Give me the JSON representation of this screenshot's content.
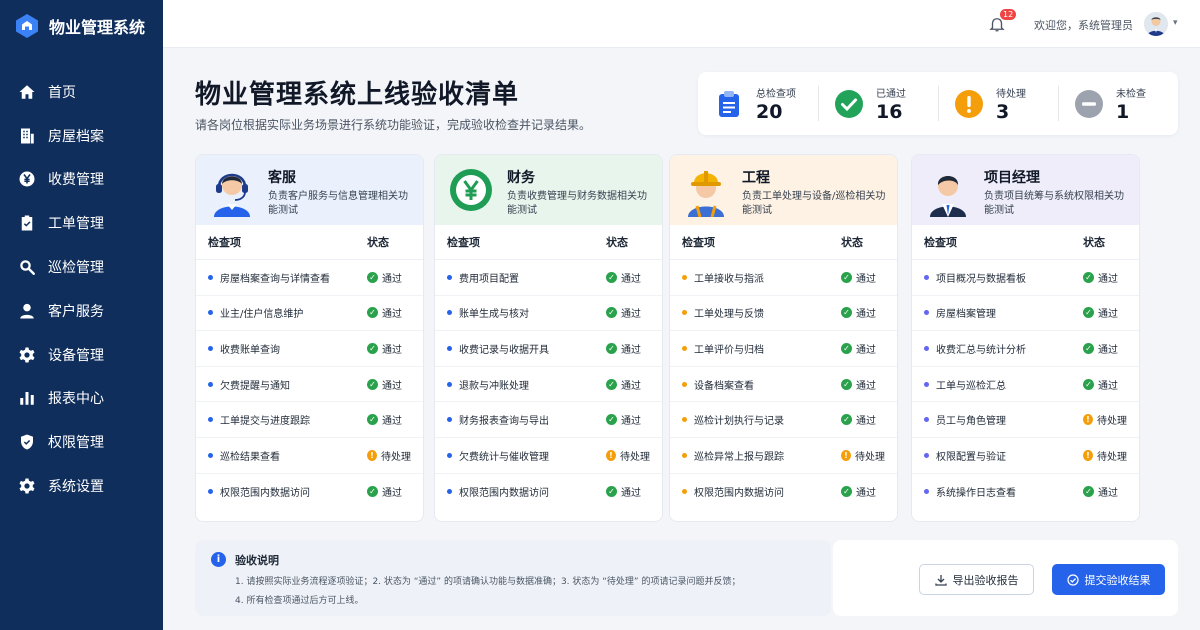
{
  "brand": {
    "title": "物业管理系统"
  },
  "sidebar": {
    "items": [
      {
        "label": "首页",
        "icon": "home-icon"
      },
      {
        "label": "房屋档案",
        "icon": "building-icon"
      },
      {
        "label": "收费管理",
        "icon": "yen-icon"
      },
      {
        "label": "工单管理",
        "icon": "clipboard-icon"
      },
      {
        "label": "巡检管理",
        "icon": "search-icon"
      },
      {
        "label": "客户服务",
        "icon": "user-icon"
      },
      {
        "label": "设备管理",
        "icon": "gear-icon"
      },
      {
        "label": "报表中心",
        "icon": "bar-chart-icon"
      },
      {
        "label": "权限管理",
        "icon": "shield-icon"
      },
      {
        "label": "系统设置",
        "icon": "settings-icon"
      }
    ]
  },
  "topbar": {
    "notification_count": "12",
    "welcome": "欢迎您，系统管理员"
  },
  "page": {
    "title": "物业管理系统上线验收清单",
    "subtitle": "请各岗位根据实际业务场景进行系统功能验证，完成验收检查并记录结果。"
  },
  "stats": [
    {
      "label": "总检查项",
      "value": "20",
      "color": "#2563eb"
    },
    {
      "label": "已通过",
      "value": "16",
      "color": "#22a35a"
    },
    {
      "label": "待处理",
      "value": "3",
      "color": "#f59e0b"
    },
    {
      "label": "未检查",
      "value": "1",
      "color": "#9ca3af"
    }
  ],
  "table_headers": {
    "item": "检查项",
    "status": "状态"
  },
  "status_colors": {
    "通过": "#2aa24c",
    "待处理": "#f59e0b"
  },
  "roles": [
    {
      "title": "客服",
      "desc": "负责客户服务与信息管理相关功能测试",
      "head_bg": "#eaf1fd",
      "dot": "#2563eb",
      "rows": [
        {
          "item": "房屋档案查询与详情查看",
          "status": "通过"
        },
        {
          "item": "业主/住户信息维护",
          "status": "通过"
        },
        {
          "item": "收费账单查询",
          "status": "通过"
        },
        {
          "item": "欠费提醒与通知",
          "status": "通过"
        },
        {
          "item": "工单提交与进度跟踪",
          "status": "通过"
        },
        {
          "item": "巡检结果查看",
          "status": "待处理"
        },
        {
          "item": "权限范围内数据访问",
          "status": "通过"
        }
      ]
    },
    {
      "title": "财务",
      "desc": "负责收费管理与财务数据相关功能测试",
      "head_bg": "#e8f5ec",
      "dot": "#2563eb",
      "rows": [
        {
          "item": "费用项目配置",
          "status": "通过"
        },
        {
          "item": "账单生成与核对",
          "status": "通过"
        },
        {
          "item": "收费记录与收据开具",
          "status": "通过"
        },
        {
          "item": "退款与冲账处理",
          "status": "通过"
        },
        {
          "item": "财务报表查询与导出",
          "status": "通过"
        },
        {
          "item": "欠费统计与催收管理",
          "status": "待处理"
        },
        {
          "item": "权限范围内数据访问",
          "status": "通过"
        }
      ]
    },
    {
      "title": "工程",
      "desc": "负责工单处理与设备/巡检相关功能测试",
      "head_bg": "#fdf2e3",
      "dot": "#f59e0b",
      "rows": [
        {
          "item": "工单接收与指派",
          "status": "通过"
        },
        {
          "item": "工单处理与反馈",
          "status": "通过"
        },
        {
          "item": "工单评价与归档",
          "status": "通过"
        },
        {
          "item": "设备档案查看",
          "status": "通过"
        },
        {
          "item": "巡检计划执行与记录",
          "status": "通过"
        },
        {
          "item": "巡检异常上报与跟踪",
          "status": "待处理"
        },
        {
          "item": "权限范围内数据访问",
          "status": "通过"
        }
      ]
    },
    {
      "title": "项目经理",
      "desc": "负责项目统筹与系统权限相关功能测试",
      "head_bg": "#eeedf9",
      "dot": "#6366f1",
      "rows": [
        {
          "item": "项目概况与数据看板",
          "status": "通过"
        },
        {
          "item": "房屋档案管理",
          "status": "通过"
        },
        {
          "item": "收费汇总与统计分析",
          "status": "通过"
        },
        {
          "item": "工单与巡检汇总",
          "status": "通过"
        },
        {
          "item": "员工与角色管理",
          "status": "待处理"
        },
        {
          "item": "权限配置与验证",
          "status": "待处理"
        },
        {
          "item": "系统操作日志查看",
          "status": "通过"
        }
      ]
    }
  ],
  "notes": {
    "title": "验收说明",
    "lines": [
      "1. 请按照实际业务流程逐项验证；2. 状态为 “通过” 的项请确认功能与数据准确；3. 状态为 “待处理” 的项请记录问题并反馈；",
      "4. 所有检查项通过后方可上线。"
    ]
  },
  "actions": {
    "export": "导出验收报告",
    "submit": "提交验收结果"
  }
}
